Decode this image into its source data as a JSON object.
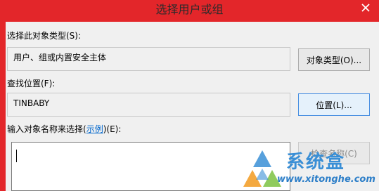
{
  "window": {
    "title": "选择用户或组"
  },
  "object_type": {
    "label": "选择此对象类型(S):",
    "value": "用户、组或内置安全主体",
    "button_label": "对象类型(O)..."
  },
  "location": {
    "label": "查找位置(F):",
    "value": "TINBABY",
    "button_label": "位置(L)..."
  },
  "names_input": {
    "label_prefix": "输入对象名称来选择(",
    "example_link": "示例",
    "label_suffix": ")(E):",
    "value": "",
    "check_button_label": "检查名称(C)"
  },
  "watermark": {
    "text": "系统盒",
    "url": "www.xitonghe.com",
    "colors": {
      "blue": "#3a8fd6",
      "orange": "#f29a1f",
      "green": "#7cc242"
    }
  },
  "icons": {
    "close": "close-icon",
    "watermark_logo": "triangle-logo-icon"
  },
  "colors": {
    "titlebar": "#e3262a",
    "client_bg": "#f0f0f0",
    "focus_border": "#4a90e2"
  }
}
